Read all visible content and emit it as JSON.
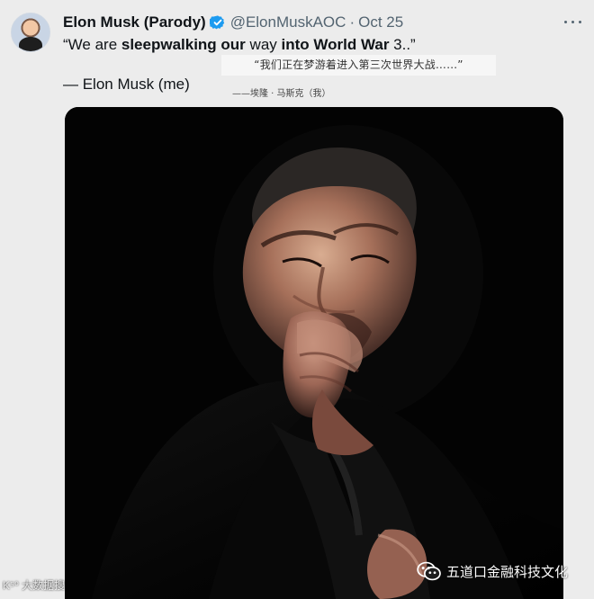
{
  "tweet": {
    "display_name": "Elon Musk (Parody)",
    "handle": "@ElonMuskAOC",
    "separator": "·",
    "date": "Oct 25",
    "quote_part_1": "“We are ",
    "quote_part_2": "sleepwalking our",
    "quote_part_3": " way ",
    "quote_part_4": "into World War",
    "quote_part_5": " 3..”",
    "translation_quote": "“我们正在梦游着进入第三次世界大战……”",
    "attribution": "— Elon Musk (me)",
    "translation_attribution": "——埃隆 · 马斯克（我）"
  },
  "watermarks": {
    "left": "大数据搜",
    "right": "五道口金融科技文化"
  },
  "icons": {
    "verified": "verified-badge-icon",
    "more": "more-options-icon",
    "wechat": "wechat-icon"
  },
  "colors": {
    "accent_blue": "#1d9bf0",
    "muted_text": "#536471",
    "background": "#ececec"
  }
}
